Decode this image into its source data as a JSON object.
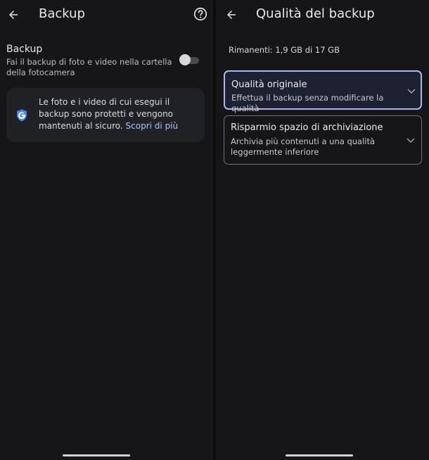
{
  "left": {
    "title": "Backup",
    "setting": {
      "title": "Backup",
      "description": "Fai il backup di foto e video nella cartella della fotocamera",
      "enabled": false
    },
    "info": {
      "text": "Le foto e i video di cui esegui il backup sono protetti e vengono mantenuti al sicuro.",
      "link": "Scopri di più"
    },
    "icons": {
      "back": "back-arrow-icon",
      "help": "help-icon",
      "shield": "google-shield-icon"
    }
  },
  "right": {
    "title": "Qualità del backup",
    "remaining": "Rimanenti: 1,9 GB di 17 GB",
    "options": [
      {
        "title": "Qualità originale",
        "description": "Effettua il backup senza modificare la qualità",
        "selected": true
      },
      {
        "title": "Risparmio spazio di archiviazione",
        "description": "Archivia più contenuti a una qualità leggermente inferiore",
        "selected": false
      }
    ],
    "icons": {
      "back": "back-arrow-icon",
      "chevron": "chevron-down-icon"
    }
  },
  "colors": {
    "background": "#161618",
    "card": "#202125",
    "accent": "#a8c4ff",
    "selected_border": "#aab7ef",
    "shield": "#4285f4"
  }
}
